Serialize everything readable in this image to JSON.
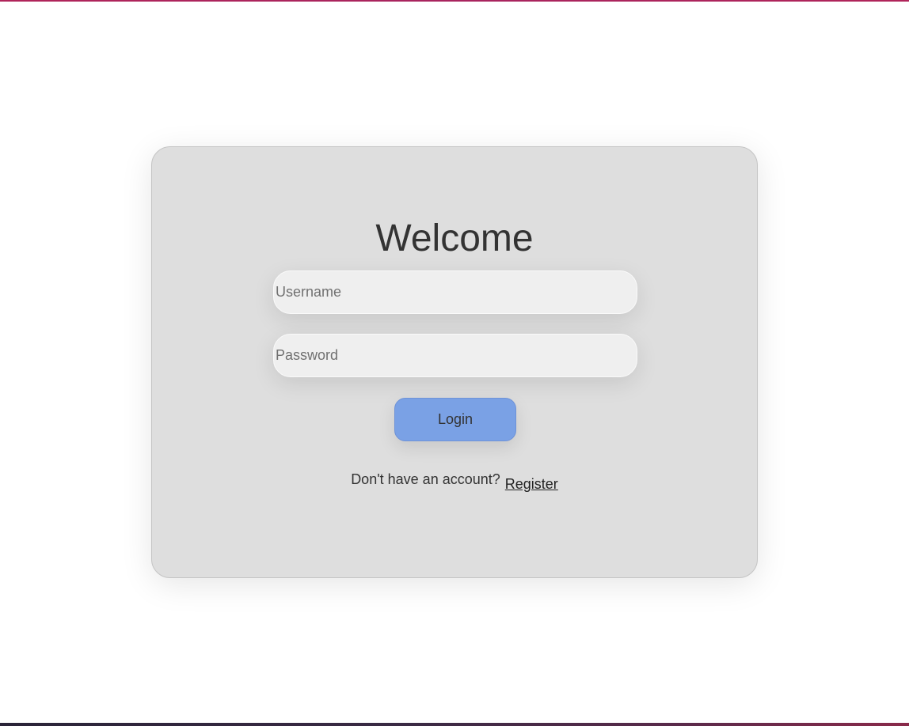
{
  "login": {
    "title": "Welcome",
    "username_placeholder": "Username",
    "password_placeholder": "Password",
    "login_label": "Login",
    "register_prompt": "Don't have an account?",
    "register_link": "Register"
  },
  "colors": {
    "card_background": "#dedede",
    "login_button": "#7aa1e5",
    "top_strip": "#b0245a"
  }
}
